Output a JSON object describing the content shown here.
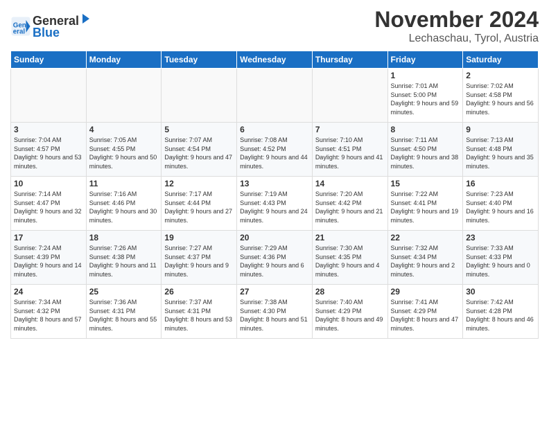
{
  "header": {
    "logo_line1": "General",
    "logo_line2": "Blue",
    "month": "November 2024",
    "location": "Lechaschau, Tyrol, Austria"
  },
  "weekdays": [
    "Sunday",
    "Monday",
    "Tuesday",
    "Wednesday",
    "Thursday",
    "Friday",
    "Saturday"
  ],
  "weeks": [
    [
      {
        "day": "",
        "info": ""
      },
      {
        "day": "",
        "info": ""
      },
      {
        "day": "",
        "info": ""
      },
      {
        "day": "",
        "info": ""
      },
      {
        "day": "",
        "info": ""
      },
      {
        "day": "1",
        "info": "Sunrise: 7:01 AM\nSunset: 5:00 PM\nDaylight: 9 hours and 59 minutes."
      },
      {
        "day": "2",
        "info": "Sunrise: 7:02 AM\nSunset: 4:58 PM\nDaylight: 9 hours and 56 minutes."
      }
    ],
    [
      {
        "day": "3",
        "info": "Sunrise: 7:04 AM\nSunset: 4:57 PM\nDaylight: 9 hours and 53 minutes."
      },
      {
        "day": "4",
        "info": "Sunrise: 7:05 AM\nSunset: 4:55 PM\nDaylight: 9 hours and 50 minutes."
      },
      {
        "day": "5",
        "info": "Sunrise: 7:07 AM\nSunset: 4:54 PM\nDaylight: 9 hours and 47 minutes."
      },
      {
        "day": "6",
        "info": "Sunrise: 7:08 AM\nSunset: 4:52 PM\nDaylight: 9 hours and 44 minutes."
      },
      {
        "day": "7",
        "info": "Sunrise: 7:10 AM\nSunset: 4:51 PM\nDaylight: 9 hours and 41 minutes."
      },
      {
        "day": "8",
        "info": "Sunrise: 7:11 AM\nSunset: 4:50 PM\nDaylight: 9 hours and 38 minutes."
      },
      {
        "day": "9",
        "info": "Sunrise: 7:13 AM\nSunset: 4:48 PM\nDaylight: 9 hours and 35 minutes."
      }
    ],
    [
      {
        "day": "10",
        "info": "Sunrise: 7:14 AM\nSunset: 4:47 PM\nDaylight: 9 hours and 32 minutes."
      },
      {
        "day": "11",
        "info": "Sunrise: 7:16 AM\nSunset: 4:46 PM\nDaylight: 9 hours and 30 minutes."
      },
      {
        "day": "12",
        "info": "Sunrise: 7:17 AM\nSunset: 4:44 PM\nDaylight: 9 hours and 27 minutes."
      },
      {
        "day": "13",
        "info": "Sunrise: 7:19 AM\nSunset: 4:43 PM\nDaylight: 9 hours and 24 minutes."
      },
      {
        "day": "14",
        "info": "Sunrise: 7:20 AM\nSunset: 4:42 PM\nDaylight: 9 hours and 21 minutes."
      },
      {
        "day": "15",
        "info": "Sunrise: 7:22 AM\nSunset: 4:41 PM\nDaylight: 9 hours and 19 minutes."
      },
      {
        "day": "16",
        "info": "Sunrise: 7:23 AM\nSunset: 4:40 PM\nDaylight: 9 hours and 16 minutes."
      }
    ],
    [
      {
        "day": "17",
        "info": "Sunrise: 7:24 AM\nSunset: 4:39 PM\nDaylight: 9 hours and 14 minutes."
      },
      {
        "day": "18",
        "info": "Sunrise: 7:26 AM\nSunset: 4:38 PM\nDaylight: 9 hours and 11 minutes."
      },
      {
        "day": "19",
        "info": "Sunrise: 7:27 AM\nSunset: 4:37 PM\nDaylight: 9 hours and 9 minutes."
      },
      {
        "day": "20",
        "info": "Sunrise: 7:29 AM\nSunset: 4:36 PM\nDaylight: 9 hours and 6 minutes."
      },
      {
        "day": "21",
        "info": "Sunrise: 7:30 AM\nSunset: 4:35 PM\nDaylight: 9 hours and 4 minutes."
      },
      {
        "day": "22",
        "info": "Sunrise: 7:32 AM\nSunset: 4:34 PM\nDaylight: 9 hours and 2 minutes."
      },
      {
        "day": "23",
        "info": "Sunrise: 7:33 AM\nSunset: 4:33 PM\nDaylight: 9 hours and 0 minutes."
      }
    ],
    [
      {
        "day": "24",
        "info": "Sunrise: 7:34 AM\nSunset: 4:32 PM\nDaylight: 8 hours and 57 minutes."
      },
      {
        "day": "25",
        "info": "Sunrise: 7:36 AM\nSunset: 4:31 PM\nDaylight: 8 hours and 55 minutes."
      },
      {
        "day": "26",
        "info": "Sunrise: 7:37 AM\nSunset: 4:31 PM\nDaylight: 8 hours and 53 minutes."
      },
      {
        "day": "27",
        "info": "Sunrise: 7:38 AM\nSunset: 4:30 PM\nDaylight: 8 hours and 51 minutes."
      },
      {
        "day": "28",
        "info": "Sunrise: 7:40 AM\nSunset: 4:29 PM\nDaylight: 8 hours and 49 minutes."
      },
      {
        "day": "29",
        "info": "Sunrise: 7:41 AM\nSunset: 4:29 PM\nDaylight: 8 hours and 47 minutes."
      },
      {
        "day": "30",
        "info": "Sunrise: 7:42 AM\nSunset: 4:28 PM\nDaylight: 8 hours and 46 minutes."
      }
    ]
  ]
}
